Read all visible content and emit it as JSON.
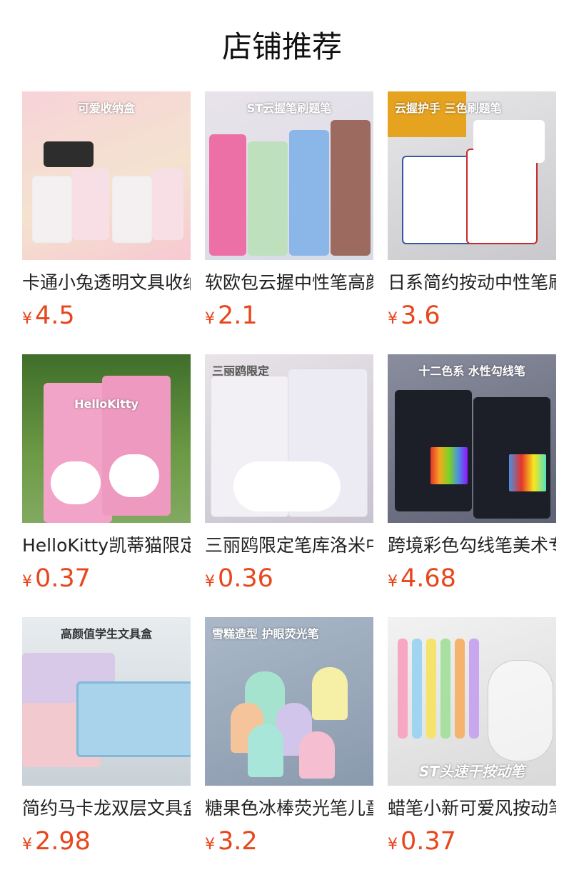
{
  "section_title": "店铺推荐",
  "currency_symbol": "¥",
  "colors": {
    "price": "#e8461d",
    "title": "#111111",
    "name": "#222222"
  },
  "products": [
    {
      "name": "卡通小兔透明文具收纳盒",
      "price": "4.5",
      "image_text": "可爱收纳盒"
    },
    {
      "name": "软欧包云握中性笔高颜值",
      "price": "2.1",
      "image_text": "ST云握笔刷题笔"
    },
    {
      "name": "日系简约按动中性笔刷题",
      "price": "3.6",
      "image_text": "云握护手 三色刷题笔"
    },
    {
      "name": "HelloKitty凯蒂猫限定中性笔",
      "price": "0.37",
      "image_text": "HelloKitty"
    },
    {
      "name": "三丽鸥限定笔库洛米中性笔",
      "price": "0.36",
      "image_text": "三丽鸥限定"
    },
    {
      "name": "跨境彩色勾线笔美术专用",
      "price": "4.68",
      "image_text": "十二色系 水性勾线笔"
    },
    {
      "name": "简约马卡龙双层文具盒",
      "price": "2.98",
      "image_text": "高颜值学生文具盒"
    },
    {
      "name": "糖果色冰棒荧光笔儿童",
      "price": "3.2",
      "image_text": "雪糕造型 护眼荧光笔"
    },
    {
      "name": "蜡笔小新可爱风按动笔",
      "price": "0.37",
      "image_text": "ST头速干按动笔"
    }
  ]
}
